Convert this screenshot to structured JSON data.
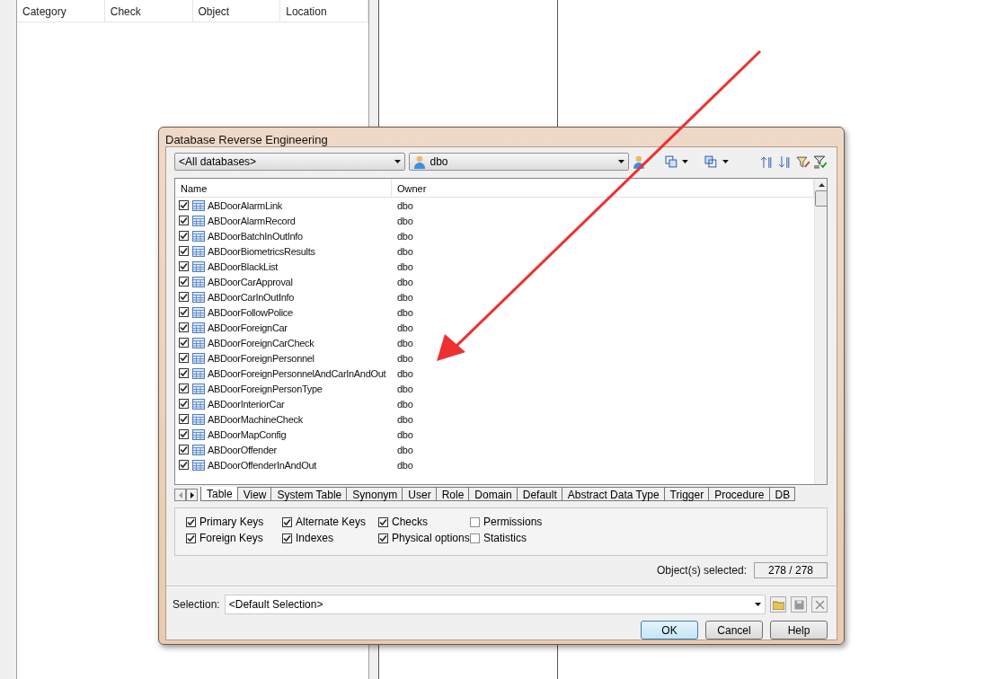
{
  "background_panel": {
    "columns": [
      "Category",
      "Check",
      "Object",
      "Location"
    ]
  },
  "dialog": {
    "title": "Database Reverse Engineering",
    "database_select": {
      "value": "<All databases>"
    },
    "owner_select": {
      "value": "dbo"
    },
    "list": {
      "columns": [
        "Name",
        "Owner"
      ],
      "rows": [
        {
          "name": "ABDoorAlarmLink",
          "owner": "dbo",
          "checked": true
        },
        {
          "name": "ABDoorAlarmRecord",
          "owner": "dbo",
          "checked": true
        },
        {
          "name": "ABDoorBatchInOutInfo",
          "owner": "dbo",
          "checked": true
        },
        {
          "name": "ABDoorBiometricsResults",
          "owner": "dbo",
          "checked": true
        },
        {
          "name": "ABDoorBlackList",
          "owner": "dbo",
          "checked": true
        },
        {
          "name": "ABDoorCarApproval",
          "owner": "dbo",
          "checked": true
        },
        {
          "name": "ABDoorCarInOutInfo",
          "owner": "dbo",
          "checked": true
        },
        {
          "name": "ABDoorFollowPolice",
          "owner": "dbo",
          "checked": true
        },
        {
          "name": "ABDoorForeignCar",
          "owner": "dbo",
          "checked": true
        },
        {
          "name": "ABDoorForeignCarCheck",
          "owner": "dbo",
          "checked": true
        },
        {
          "name": "ABDoorForeignPersonnel",
          "owner": "dbo",
          "checked": true
        },
        {
          "name": "ABDoorForeignPersonnelAndCarInAndOut",
          "owner": "dbo",
          "checked": true
        },
        {
          "name": "ABDoorForeignPersonType",
          "owner": "dbo",
          "checked": true
        },
        {
          "name": "ABDoorInteriorCar",
          "owner": "dbo",
          "checked": true
        },
        {
          "name": "ABDoorMachineCheck",
          "owner": "dbo",
          "checked": true
        },
        {
          "name": "ABDoorMapConfig",
          "owner": "dbo",
          "checked": true
        },
        {
          "name": "ABDoorOffender",
          "owner": "dbo",
          "checked": true
        },
        {
          "name": "ABDoorOffenderInAndOut",
          "owner": "dbo",
          "checked": true
        }
      ]
    },
    "tabs": [
      {
        "label": "Table",
        "selected": true
      },
      {
        "label": "View",
        "selected": false
      },
      {
        "label": "System Table",
        "selected": false
      },
      {
        "label": "Synonym",
        "selected": false
      },
      {
        "label": "User",
        "selected": false
      },
      {
        "label": "Role",
        "selected": false
      },
      {
        "label": "Domain",
        "selected": false
      },
      {
        "label": "Default",
        "selected": false
      },
      {
        "label": "Abstract Data Type",
        "selected": false
      },
      {
        "label": "Trigger",
        "selected": false
      },
      {
        "label": "Procedure",
        "selected": false
      },
      {
        "label": "DB",
        "selected": false
      }
    ],
    "options": [
      {
        "label": "Primary Keys",
        "checked": true
      },
      {
        "label": "Foreign Keys",
        "checked": true
      },
      {
        "label": "Alternate Keys",
        "checked": true
      },
      {
        "label": "Indexes",
        "checked": true
      },
      {
        "label": "Checks",
        "checked": true
      },
      {
        "label": "Physical options",
        "checked": true
      },
      {
        "label": "Permissions",
        "checked": false
      },
      {
        "label": "Statistics",
        "checked": false
      }
    ],
    "objects_selected": {
      "label": "Object(s) selected:",
      "value": "278 / 278"
    },
    "selection": {
      "label": "Selection:",
      "value": "<Default Selection>"
    },
    "buttons": [
      {
        "label": "OK",
        "selected": true
      },
      {
        "label": "Cancel",
        "selected": false
      },
      {
        "label": "Help",
        "selected": false
      }
    ]
  }
}
